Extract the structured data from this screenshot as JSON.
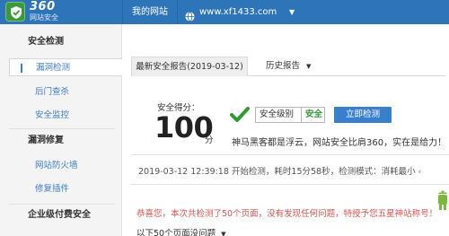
{
  "brand": {
    "logo_number": "360",
    "logo_subtitle": "网站安全",
    "colors": {
      "topbar": "#2e74b9",
      "accent": "#3a7fcb",
      "safe_green": "#2f9a2f",
      "alert_red": "#d9534f"
    }
  },
  "topnav": {
    "my_site": "我的网站",
    "domain": "www.xf1433.com",
    "domain_icon": "globe-icon"
  },
  "sidebar": {
    "sections": [
      {
        "heading": "安全检测",
        "items": [
          {
            "label": "漏洞检测",
            "active": true
          },
          {
            "label": "后门查杀",
            "active": false
          },
          {
            "label": "安全监控",
            "active": false
          }
        ]
      },
      {
        "heading": "漏洞修复",
        "items": [
          {
            "label": "网站防火墙",
            "active": false
          },
          {
            "label": "修复插件",
            "active": false
          }
        ]
      },
      {
        "heading": "企业级付费安全",
        "items": []
      }
    ]
  },
  "tabs": {
    "latest": "最新安全报告(2019-03-12)",
    "history": "历史报告"
  },
  "score": {
    "label": "安全得分：",
    "value": "100",
    "unit": "分",
    "level_label": "安全级别",
    "level_value": "安全",
    "detect_button": "立即检测",
    "quote": "神马黑客都是浮云，网站安全比肩360，实在是给力！"
  },
  "scan": {
    "summary": "2019-03-12 12:39:18 开始检测，耗时15分58秒，检测模式：消耗最小",
    "back_icon": "‹"
  },
  "result": {
    "congrats": "恭喜您，本次共检测了50个页面，没有发现任何问题，特授予您五星神站称号！",
    "footer": "以下50个页面没问题"
  }
}
